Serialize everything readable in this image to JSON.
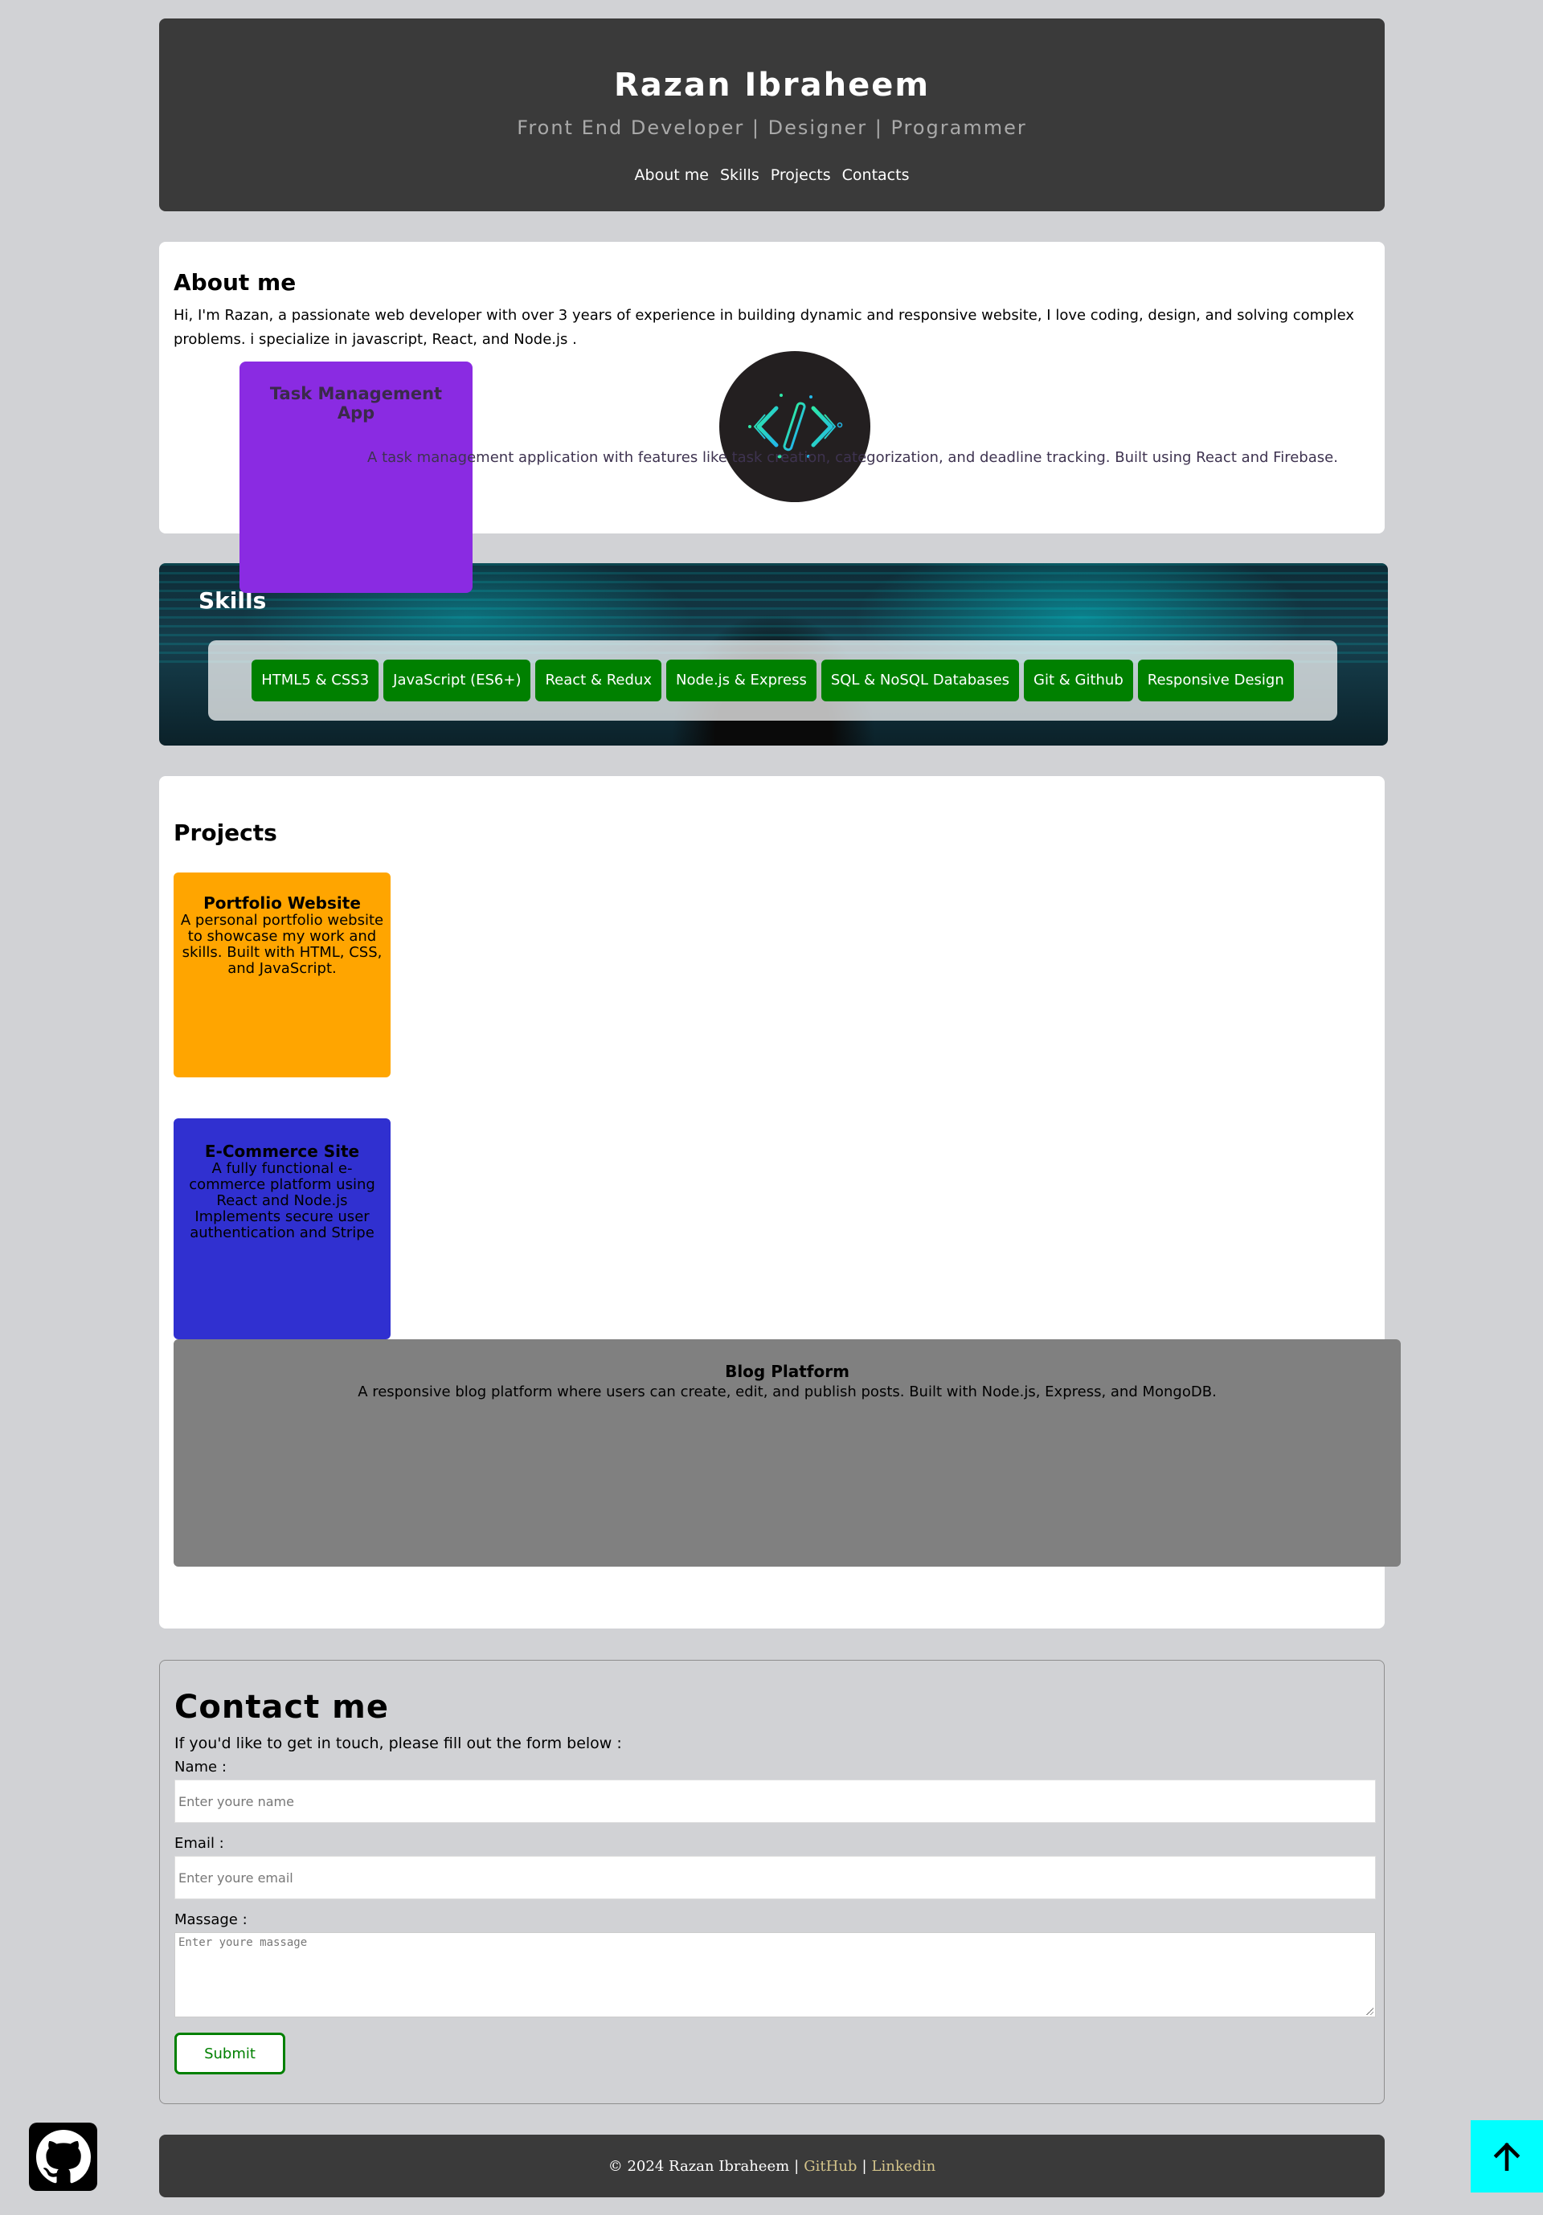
{
  "header": {
    "name": "Razan Ibraheem",
    "subtitle": "Front End Developer | Designer | Programmer",
    "nav": [
      "About me",
      "Skills",
      "Projects",
      "Contacts"
    ]
  },
  "about": {
    "title": "About me",
    "text": "Hi, I'm Razan, a passionate web developer with over 3 years of experience in building dynamic and responsive website, I love coding, design, and solving complex problems. i specialize in javascript, React, and Node.js .",
    "task_card": {
      "title": "Task Management App",
      "text": "A task management application with features like task creation, categorization, and deadline tracking. Built using React and Firebase."
    },
    "logo_icon": "code-brackets-icon"
  },
  "skills": {
    "title": "Skills",
    "items": [
      "HTML5 & CSS3",
      "JavaScript (ES6+)",
      "React & Redux",
      "Node.js & Express",
      "SQL & NoSQL Databases",
      "Git & Github",
      "Responsive Design"
    ]
  },
  "projects": {
    "title": "Projects",
    "items": [
      {
        "title": "Portfolio Website",
        "text": "A personal portfolio website to showcase my work and skills. Built with HTML, CSS, and JavaScript.",
        "color": "#ffa500"
      },
      {
        "title": "E-Commerce Site",
        "text": "A fully functional e-commerce platform using React and Node.js Implements secure user authentication and Stripe",
        "color": "#3030d0"
      },
      {
        "title": "Blog Platform",
        "text": "A responsive blog platform where users can create, edit, and publish posts. Built with Node.js, Express, and MongoDB.",
        "color": "#808080"
      }
    ]
  },
  "contact": {
    "title": "Contact me",
    "intro": "If you'd like to get in touch, please fill out the form below :",
    "name_label": "Name :",
    "name_placeholder": "Enter youre name",
    "email_label": "Email :",
    "email_placeholder": "Enter youre email",
    "message_label": "Massage :",
    "message_placeholder": "Enter youre massage",
    "submit": "Submit"
  },
  "footer": {
    "copyright": "© 2024 Razan Ibraheem",
    "separator": "|",
    "github": "GitHub",
    "linkedin": "Linkedin"
  },
  "floating": {
    "github_icon": "github-icon",
    "top_icon": "arrow-up-icon",
    "top_color": "#00ffff"
  }
}
